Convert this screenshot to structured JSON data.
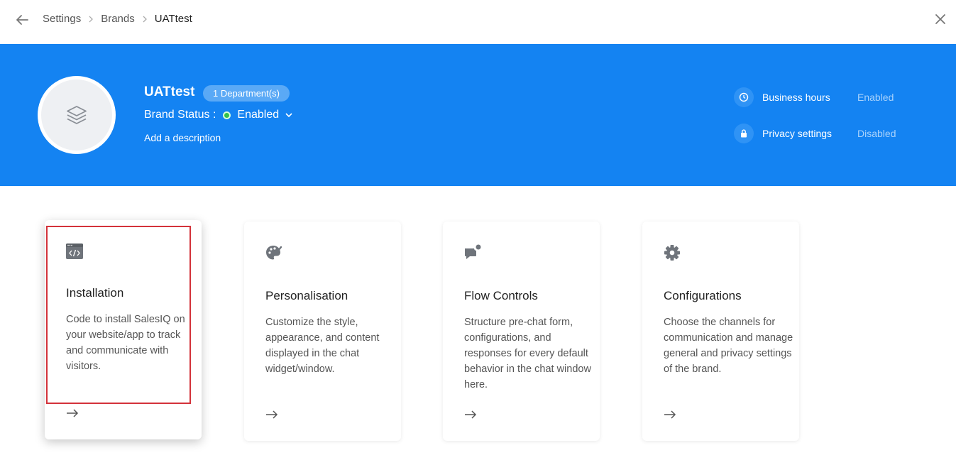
{
  "breadcrumb": {
    "items": [
      "Settings",
      "Brands"
    ],
    "current": "UATtest"
  },
  "brand": {
    "name": "UATtest",
    "departments_badge": "1 Department(s)",
    "status_label": "Brand Status :",
    "status_value": "Enabled",
    "add_description": "Add a description"
  },
  "settings": {
    "business_hours": {
      "label": "Business hours",
      "state": "Enabled"
    },
    "privacy": {
      "label": "Privacy settings",
      "state": "Disabled"
    }
  },
  "cards": [
    {
      "title": "Installation",
      "description": "Code to install SalesIQ on your website/app to track and communicate with visitors.",
      "icon": "code-window-icon"
    },
    {
      "title": "Personalisation",
      "description": "Customize the style, appearance, and content displayed in the chat widget/window.",
      "icon": "palette-icon"
    },
    {
      "title": "Flow Controls",
      "description": "Structure pre-chat form, configurations, and responses for every default behavior in the chat window here.",
      "icon": "chat-notification-icon"
    },
    {
      "title": "Configurations",
      "description": "Choose the channels for communication and manage general and privacy settings of the brand.",
      "icon": "gear-icon"
    }
  ],
  "colors": {
    "banner": "#1483f2",
    "status_dot": "#35c14a",
    "highlight": "#d3323a"
  }
}
